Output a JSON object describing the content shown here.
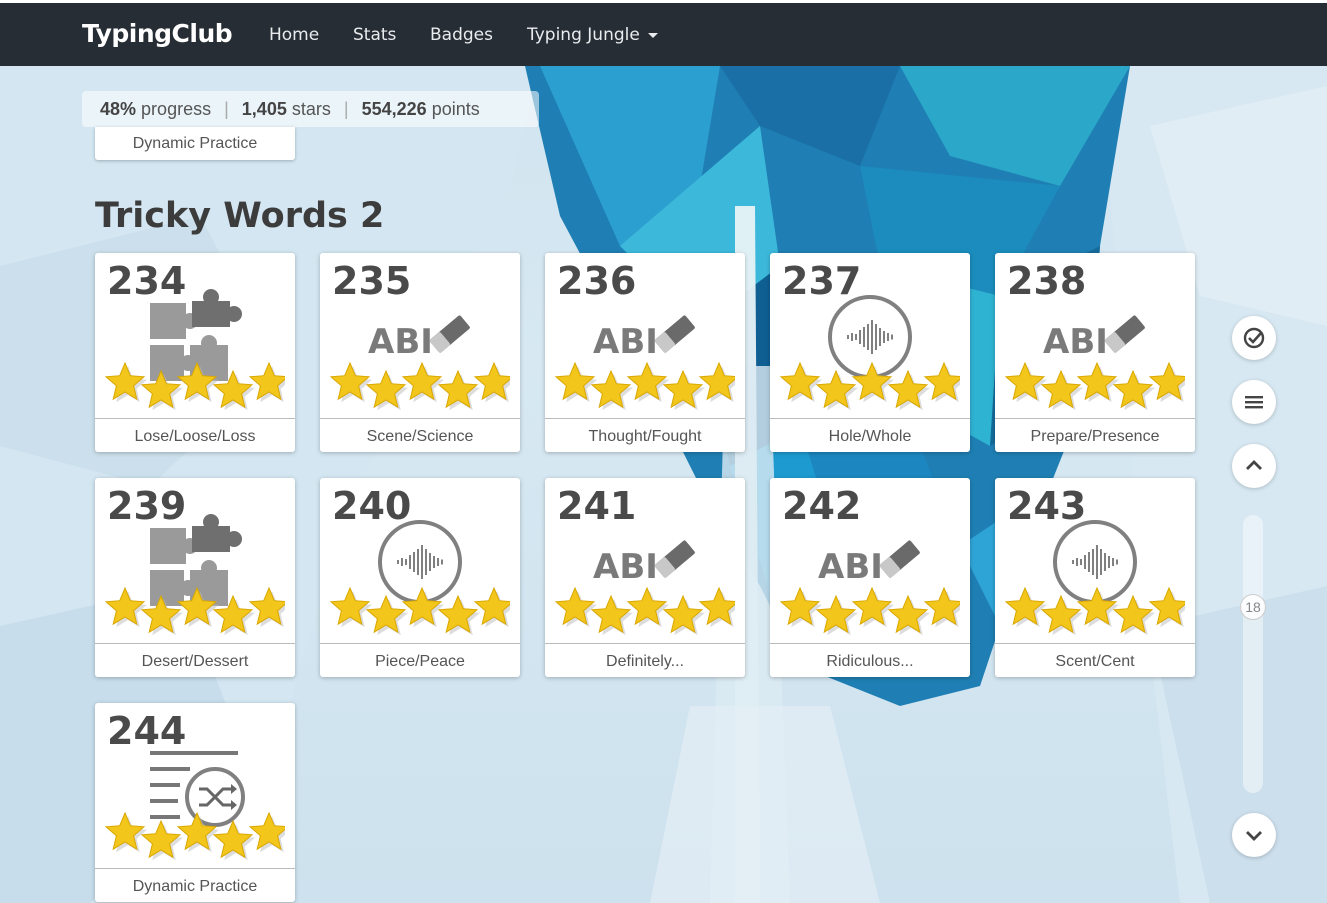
{
  "app": {
    "brand": "TypingClub"
  },
  "nav": {
    "home": "Home",
    "stats": "Stats",
    "badges": "Badges",
    "jungle": "Typing Jungle"
  },
  "progress": {
    "percent": "48%",
    "percent_label": "progress",
    "stars": "1,405",
    "stars_label": "stars",
    "points": "554,226",
    "points_label": "points"
  },
  "previous_card_label": "Dynamic Practice",
  "section_title": "Tricky Words 2",
  "cards": [
    {
      "num": "234",
      "label": "Lose/Loose/Loss",
      "icon": "puzzle-icon",
      "stars": 5
    },
    {
      "num": "235",
      "label": "Scene/Science",
      "icon": "abc-eraser-icon",
      "stars": 5
    },
    {
      "num": "236",
      "label": "Thought/Fought",
      "icon": "abc-eraser-icon",
      "stars": 5
    },
    {
      "num": "237",
      "label": "Hole/Whole",
      "icon": "audio-wave-icon",
      "stars": 5
    },
    {
      "num": "238",
      "label": "Prepare/Presence",
      "icon": "abc-eraser-icon",
      "stars": 5
    },
    {
      "num": "239",
      "label": "Desert/Dessert",
      "icon": "puzzle-icon",
      "stars": 5
    },
    {
      "num": "240",
      "label": "Piece/Peace",
      "icon": "audio-wave-icon",
      "stars": 5
    },
    {
      "num": "241",
      "label": "Definitely...",
      "icon": "abc-eraser-icon",
      "stars": 5
    },
    {
      "num": "242",
      "label": "Ridiculous...",
      "icon": "abc-eraser-icon",
      "stars": 5
    },
    {
      "num": "243",
      "label": "Scent/Cent",
      "icon": "audio-wave-icon",
      "stars": 5
    },
    {
      "num": "244",
      "label": "Dynamic Practice",
      "icon": "shuffle-list-icon",
      "stars": 5
    }
  ],
  "icon_text": {
    "abc": "ABI"
  },
  "sidebar": {
    "scroll_position": "18"
  },
  "colors": {
    "topbar": "#272d34",
    "star": "#f3c61b",
    "accent_blue": "#1a8fb8"
  }
}
